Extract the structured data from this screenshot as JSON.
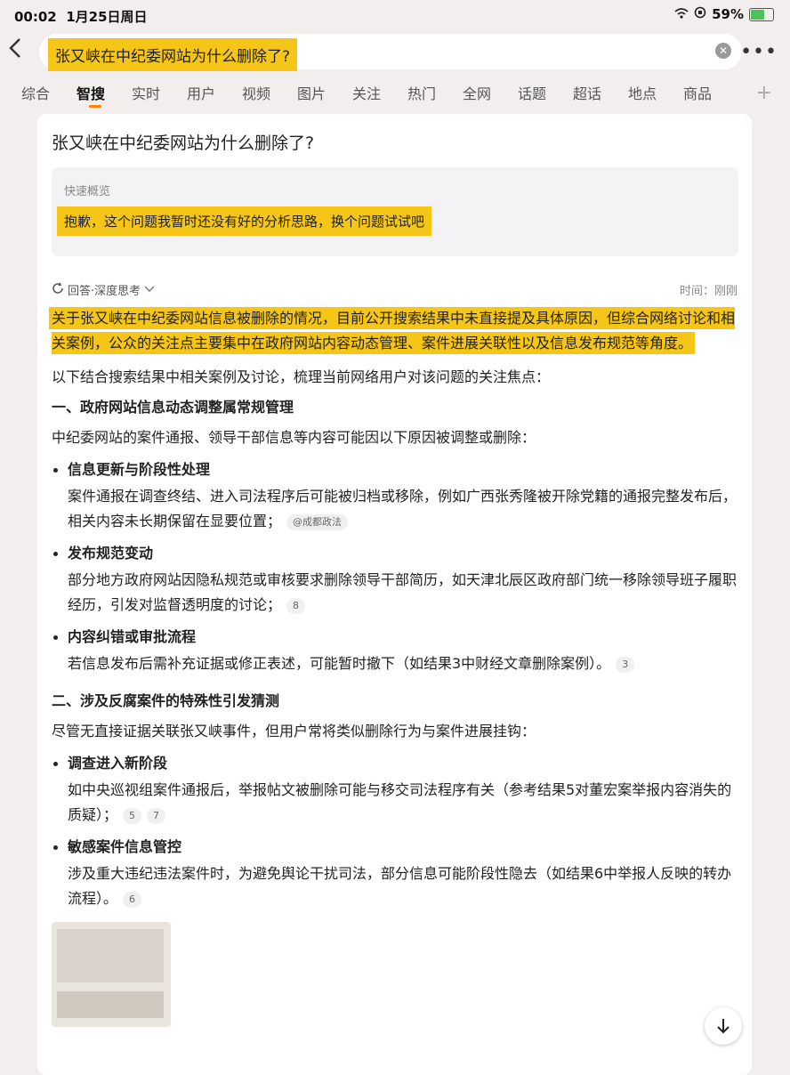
{
  "status_bar": {
    "time": "00:02",
    "date": "1月25日周日",
    "battery": "59%"
  },
  "search": {
    "query": "张又峡在中纪委网站为什么删除了?"
  },
  "tabs": [
    "综合",
    "智搜",
    "实时",
    "用户",
    "视频",
    "图片",
    "关注",
    "热门",
    "全网",
    "话题",
    "超话",
    "地点",
    "商品"
  ],
  "card": {
    "question": "张又峡在中纪委网站为什么删除了?",
    "summary_label": "快速概览",
    "summary_text": "抱歉，这个问题我暂时还没有好的分析思路，换个问题试试吧",
    "answer_label": "回答·深度思考",
    "answer_time": "时间：刚刚",
    "lead": "关于张又峡在中纪委网站信息被删除的情况，目前公开搜索结果中未直接提及具体原因，但综合网络讨论和相关案例，公众的关注点主要集中在政府网站内容动态管理、案件进展关联性以及信息发布规范等角度。",
    "intro": "以下结合搜索结果中相关案例及讨论，梳理当前网络用户对该问题的关注焦点：",
    "section1": {
      "heading": "一、政府网站信息动态调整属常规管理",
      "intro": "中纪委网站的案件通报、领导干部信息等内容可能因以下原因被调整或删除：",
      "bullets": [
        {
          "title": "信息更新与阶段性处理",
          "body": "案件通报在调查终结、进入司法程序后可能被归档或移除，例如广西张秀隆被开除党籍的通报完整发布后，相关内容未长期保留在显要位置；",
          "cite": "@成都政法"
        },
        {
          "title": "发布规范变动",
          "body": "部分地方政府网站因隐私规范或审核要求删除领导干部简历，如天津北辰区政府部门统一移除领导班子履职经历，引发对监督透明度的讨论；",
          "cite": "8"
        },
        {
          "title": "内容纠错或审批流程",
          "body": "若信息发布后需补充证据或修正表述，可能暂时撤下（如结果3中财经文章删除案例）。",
          "cite": "3"
        }
      ]
    },
    "section2": {
      "heading": "二、涉及反腐案件的特殊性引发猜测",
      "intro": "尽管无直接证据关联张又峡事件，但用户常将类似删除行为与案件进展挂钩：",
      "bullets": [
        {
          "title": "调查进入新阶段",
          "body": "如中央巡视组案件通报后，举报帖文被删除可能与移交司法程序有关（参考结果5对董宏案举报内容消失的质疑）；",
          "cites": [
            "5",
            "7"
          ]
        },
        {
          "title": "敏感案件信息管控",
          "body": "涉及重大违纪违法案件时，为避免舆论干扰司法，部分信息可能阶段性隐去（如结果6中举报人反映的转办流程）。",
          "cite": "6"
        }
      ]
    }
  }
}
